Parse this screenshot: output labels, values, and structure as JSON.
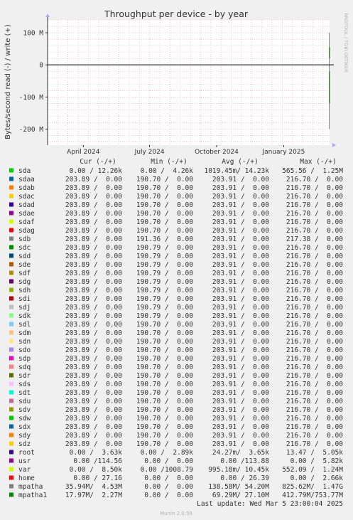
{
  "chart_data": {
    "type": "line",
    "title": "Throughput per device - by year",
    "ylabel": "Bytes/second read (-) / write (+)",
    "watermark": "RRDTOOL / TOBI OETIKER",
    "footer": "Munin 2.0.56",
    "last_update": "Last update: Wed Mar  5 23:00:04 2025",
    "ylim": [
      -250000000,
      140000000
    ],
    "y_ticks": [
      {
        "value": 100000000,
        "label": "100 M"
      },
      {
        "value": 0,
        "label": "0"
      },
      {
        "value": -100000000,
        "label": "-100 M"
      },
      {
        "value": -200000000,
        "label": "-200 M"
      }
    ],
    "x_range": [
      "2024-02-12",
      "2025-03-05"
    ],
    "x_ticks": [
      {
        "date": "2024-04-01",
        "label": "April 2024"
      },
      {
        "date": "2024-07-01",
        "label": "July 2024"
      },
      {
        "date": "2024-10-01",
        "label": "October 2024"
      },
      {
        "date": "2025-01-01",
        "label": "January 2025"
      }
    ],
    "grid": true,
    "colors": {
      "background": "#f0f0f0",
      "canvas": "#ffffff",
      "minor_grid": "#e8a0a0",
      "axis": "#000000",
      "text": "#333333"
    },
    "column_headers": [
      "Cur (-/+)",
      "Min (-/+)",
      "Avg (-/+)",
      "Max (-/+)"
    ],
    "series": [
      {
        "name": "sda",
        "color": "#00cc00",
        "cur": " 0.00 / 12.26k",
        "min": "  0.00 /  4.26k",
        "avg": "1019.45m/ 14.23k",
        "max": "565.56 /  1.25M"
      },
      {
        "name": "sdaa",
        "color": "#0066b3",
        "cur": "203.89 /  0.00",
        "min": "190.70 /  0.00",
        "avg": "203.91 /  0.00",
        "max": "216.70 /  0.00"
      },
      {
        "name": "sdab",
        "color": "#ff8000",
        "cur": "203.89 /  0.00",
        "min": "190.70 /  0.00",
        "avg": "203.91 /  0.00",
        "max": "216.70 /  0.00"
      },
      {
        "name": "sdac",
        "color": "#ffcc00",
        "cur": "203.89 /  0.00",
        "min": "190.70 /  0.00",
        "avg": "203.91 /  0.00",
        "max": "216.70 /  0.00"
      },
      {
        "name": "sdad",
        "color": "#330099",
        "cur": "203.89 /  0.00",
        "min": "190.70 /  0.00",
        "avg": "203.91 /  0.00",
        "max": "216.70 /  0.00"
      },
      {
        "name": "sdae",
        "color": "#990099",
        "cur": "203.89 /  0.00",
        "min": "190.70 /  0.00",
        "avg": "203.91 /  0.00",
        "max": "216.70 /  0.00"
      },
      {
        "name": "sdaf",
        "color": "#ccff00",
        "cur": "203.89 /  0.00",
        "min": "190.70 /  0.00",
        "avg": "203.91 /  0.00",
        "max": "216.70 /  0.00"
      },
      {
        "name": "sdag",
        "color": "#ff0000",
        "cur": "203.89 /  0.00",
        "min": "190.70 /  0.00",
        "avg": "203.91 /  0.00",
        "max": "216.70 /  0.00"
      },
      {
        "name": "sdb",
        "color": "#808080",
        "cur": "203.89 /  0.00",
        "min": "191.36 /  0.00",
        "avg": "203.91 /  0.00",
        "max": "217.38 /  0.00"
      },
      {
        "name": "sdc",
        "color": "#008f00",
        "cur": "203.89 /  0.00",
        "min": "190.79 /  0.00",
        "avg": "203.91 /  0.00",
        "max": "216.70 /  0.00"
      },
      {
        "name": "sdd",
        "color": "#00487d",
        "cur": "203.89 /  0.00",
        "min": "190.79 /  0.00",
        "avg": "203.91 /  0.00",
        "max": "216.70 /  0.00"
      },
      {
        "name": "sde",
        "color": "#b35a00",
        "cur": "203.89 /  0.00",
        "min": "190.79 /  0.00",
        "avg": "203.91 /  0.00",
        "max": "216.70 /  0.00"
      },
      {
        "name": "sdf",
        "color": "#b38f00",
        "cur": "203.89 /  0.00",
        "min": "190.79 /  0.00",
        "avg": "203.91 /  0.00",
        "max": "216.70 /  0.00"
      },
      {
        "name": "sdg",
        "color": "#6b006b",
        "cur": "203.89 /  0.00",
        "min": "190.79 /  0.00",
        "avg": "203.91 /  0.00",
        "max": "216.70 /  0.00"
      },
      {
        "name": "sdh",
        "color": "#8fb300",
        "cur": "203.89 /  0.00",
        "min": "190.79 /  0.00",
        "avg": "203.91 /  0.00",
        "max": "216.70 /  0.00"
      },
      {
        "name": "sdi",
        "color": "#b30000",
        "cur": "203.89 /  0.00",
        "min": "190.79 /  0.00",
        "avg": "203.91 /  0.00",
        "max": "216.70 /  0.00"
      },
      {
        "name": "sdj",
        "color": "#bebebe",
        "cur": "203.89 /  0.00",
        "min": "190.79 /  0.00",
        "avg": "203.91 /  0.00",
        "max": "216.70 /  0.00"
      },
      {
        "name": "sdk",
        "color": "#80ff80",
        "cur": "203.89 /  0.00",
        "min": "190.79 /  0.00",
        "avg": "203.91 /  0.00",
        "max": "216.70 /  0.00"
      },
      {
        "name": "sdl",
        "color": "#80c9ff",
        "cur": "203.89 /  0.00",
        "min": "190.70 /  0.00",
        "avg": "203.91 /  0.00",
        "max": "216.70 /  0.00"
      },
      {
        "name": "sdm",
        "color": "#ffc080",
        "cur": "203.89 /  0.00",
        "min": "190.70 /  0.00",
        "avg": "203.91 /  0.00",
        "max": "216.70 /  0.00"
      },
      {
        "name": "sdn",
        "color": "#ffe680",
        "cur": "203.89 /  0.00",
        "min": "190.70 /  0.00",
        "avg": "203.91 /  0.00",
        "max": "216.70 /  0.00"
      },
      {
        "name": "sdo",
        "color": "#aa80ff",
        "cur": "203.89 /  0.00",
        "min": "190.70 /  0.00",
        "avg": "203.91 /  0.00",
        "max": "216.70 /  0.00"
      },
      {
        "name": "sdp",
        "color": "#ee00cc",
        "cur": "203.89 /  0.00",
        "min": "190.70 /  0.00",
        "avg": "203.91 /  0.00",
        "max": "216.70 /  0.00"
      },
      {
        "name": "sdq",
        "color": "#ff8080",
        "cur": "203.89 /  0.00",
        "min": "190.70 /  0.00",
        "avg": "203.91 /  0.00",
        "max": "216.70 /  0.00"
      },
      {
        "name": "sdr",
        "color": "#666600",
        "cur": "203.89 /  0.00",
        "min": "190.70 /  0.00",
        "avg": "203.91 /  0.00",
        "max": "216.70 /  0.00"
      },
      {
        "name": "sds",
        "color": "#ffbfff",
        "cur": "203.89 /  0.00",
        "min": "190.70 /  0.00",
        "avg": "203.91 /  0.00",
        "max": "216.70 /  0.00"
      },
      {
        "name": "sdt",
        "color": "#00ffcc",
        "cur": "203.89 /  0.00",
        "min": "190.70 /  0.00",
        "avg": "203.91 /  0.00",
        "max": "216.70 /  0.00"
      },
      {
        "name": "sdu",
        "color": "#cc6699",
        "cur": "203.89 /  0.00",
        "min": "190.70 /  0.00",
        "avg": "203.91 /  0.00",
        "max": "216.70 /  0.00"
      },
      {
        "name": "sdv",
        "color": "#999900",
        "cur": "203.89 /  0.00",
        "min": "190.70 /  0.00",
        "avg": "203.91 /  0.00",
        "max": "216.70 /  0.00"
      },
      {
        "name": "sdw",
        "color": "#00cc00",
        "cur": "203.89 /  0.00",
        "min": "190.70 /  0.00",
        "avg": "203.91 /  0.00",
        "max": "216.70 /  0.00"
      },
      {
        "name": "sdx",
        "color": "#0066b3",
        "cur": "203.89 /  0.00",
        "min": "190.70 /  0.00",
        "avg": "203.91 /  0.00",
        "max": "216.70 /  0.00"
      },
      {
        "name": "sdy",
        "color": "#ff8000",
        "cur": "203.89 /  0.00",
        "min": "190.70 /  0.00",
        "avg": "203.91 /  0.00",
        "max": "216.70 /  0.00"
      },
      {
        "name": "sdz",
        "color": "#ffcc00",
        "cur": "203.89 /  0.00",
        "min": "190.70 /  0.00",
        "avg": "203.91 /  0.00",
        "max": "216.70 /  0.00"
      },
      {
        "name": "root",
        "color": "#330099",
        "cur": "  0.00 /  3.63k",
        "min": "  0.00 /  2.89k",
        "avg": " 24.27m/  3.65k",
        "max": " 13.47 /  5.05k"
      },
      {
        "name": "usr",
        "color": "#990099",
        "cur": "  0.00 /114.56",
        "min": "  0.00 /  0.00",
        "avg": "  0.00 /113.88",
        "max": "  0.00 /  5.82k"
      },
      {
        "name": "var",
        "color": "#ccff00",
        "cur": "  0.00 /  8.50k",
        "min": "  0.00 /1008.79",
        "avg": "995.18m/ 10.45k",
        "max": "552.09 /  1.24M"
      },
      {
        "name": "home",
        "color": "#ff0000",
        "cur": "  0.00 / 27.16",
        "min": "  0.00 /  0.00",
        "avg": "  0.00 / 26.39",
        "max": "  0.00 /  2.66k"
      },
      {
        "name": "mpatha",
        "color": "#808080",
        "cur": "35.94M/  4.53M",
        "min": "  0.00 /  0.00",
        "avg": "138.58M/ 54.20M",
        "max": "825.62M/  1.47G"
      },
      {
        "name": "mpatha1",
        "color": "#008f00",
        "cur": "17.97M/  2.27M",
        "min": "  0.00 /  0.00",
        "avg": "69.29M/ 27.10M",
        "max": "412.79M/753.77M"
      }
    ]
  }
}
